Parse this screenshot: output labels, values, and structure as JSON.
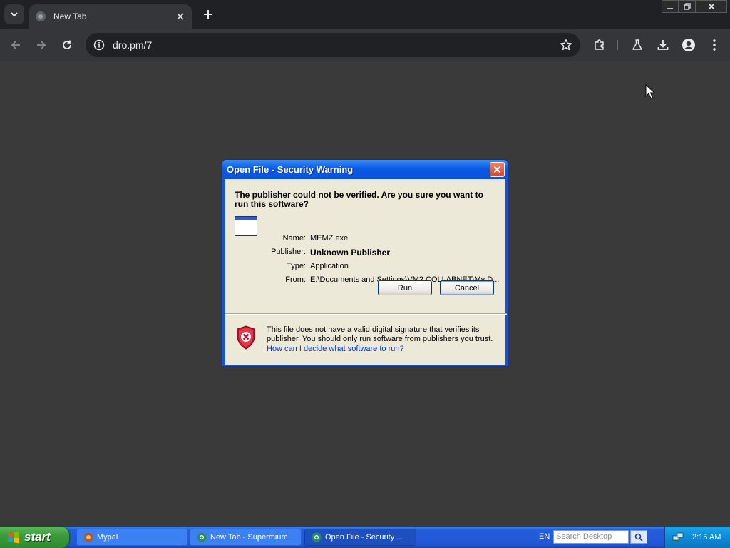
{
  "browser": {
    "tab_title": "New Tab",
    "url": "dro.pm/7"
  },
  "dialog": {
    "title": "Open File - Security Warning",
    "question": "The publisher could not be verified.  Are you sure you want to run this software?",
    "fields": [
      {
        "label": "Name:",
        "value": "MEMZ.exe"
      },
      {
        "label": "Publisher:",
        "value": "Unknown Publisher"
      },
      {
        "label": "Type:",
        "value": "Application"
      },
      {
        "label": "From:",
        "value": "E:\\Documents and Settings\\VM2.COLLABNET\\My D..."
      }
    ],
    "run_label": "Run",
    "cancel_label": "Cancel",
    "warning": "This file does not have a valid digital signature that verifies its publisher.  You should only run software from publishers you trust.",
    "link": "How can I decide what software to run?"
  },
  "taskbar": {
    "start_label": "start",
    "items": [
      {
        "label": "Mypal"
      },
      {
        "label": "New Tab - Supermium"
      },
      {
        "label": "Open File - Security ..."
      }
    ],
    "language": "EN",
    "search_placeholder": "Search Desktop",
    "clock": "2:15 AM"
  },
  "colors": {
    "xp_blue": "#0a56e8",
    "dialog_face": "#ece9d8",
    "start_green": "#3c9c3c",
    "browser_dark": "#202124",
    "link_blue": "#0033cc"
  }
}
